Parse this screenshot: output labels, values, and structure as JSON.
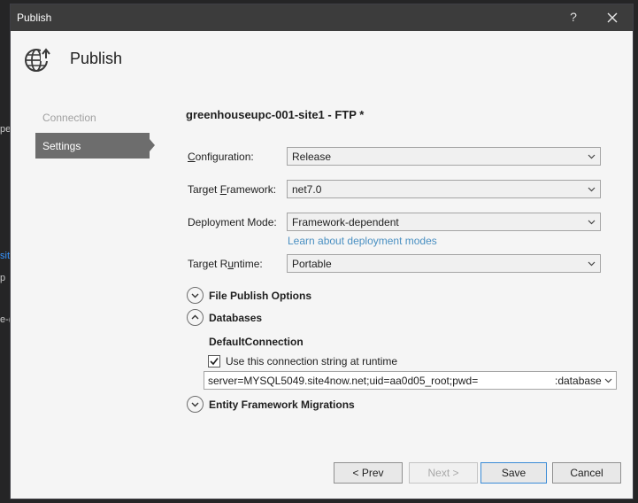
{
  "background_ide": {
    "fragments": [
      "pe",
      "site",
      "p",
      "e-("
    ]
  },
  "dialog": {
    "title": "Publish",
    "help_label": "?",
    "header_title": "Publish"
  },
  "nav": {
    "connection": "Connection",
    "settings": "Settings"
  },
  "profile": {
    "name": "greenhouseupc-001-site1 - FTP *"
  },
  "form": {
    "configuration": {
      "label_pre": "",
      "label_key": "C",
      "label_post": "onfiguration:",
      "value": "Release"
    },
    "target_framework": {
      "label_pre": "Target ",
      "label_key": "F",
      "label_post": "ramework:",
      "value": "net7.0"
    },
    "deployment_mode": {
      "label_pre": "Deployment Mode:",
      "label_key": "",
      "label_post": "",
      "value": "Framework-dependent"
    },
    "learn_link": "Learn about deployment modes",
    "target_runtime": {
      "label_pre": "Target R",
      "label_key": "u",
      "label_post": "ntime:",
      "value": "Portable"
    }
  },
  "sections": {
    "file_publish": "File Publish Options",
    "databases": "Databases",
    "ef_migrations": "Entity Framework Migrations"
  },
  "databases": {
    "connection_name": "DefaultConnection",
    "use_at_runtime_label": "Use this connection string at runtime",
    "use_at_runtime_checked": true,
    "connection_string_left": "server=MYSQL5049.site4now.net;uid=aa0d05_root;pwd=",
    "connection_string_right": ":database"
  },
  "buttons": {
    "prev": "< Prev",
    "next": "Next >",
    "save": "Save",
    "cancel": "Cancel"
  },
  "colors": {
    "titlebar": "#3c3c3c",
    "nav_selected": "#6d6d6d",
    "link": "#4a90c2",
    "primary_border": "#3a8bd6"
  }
}
